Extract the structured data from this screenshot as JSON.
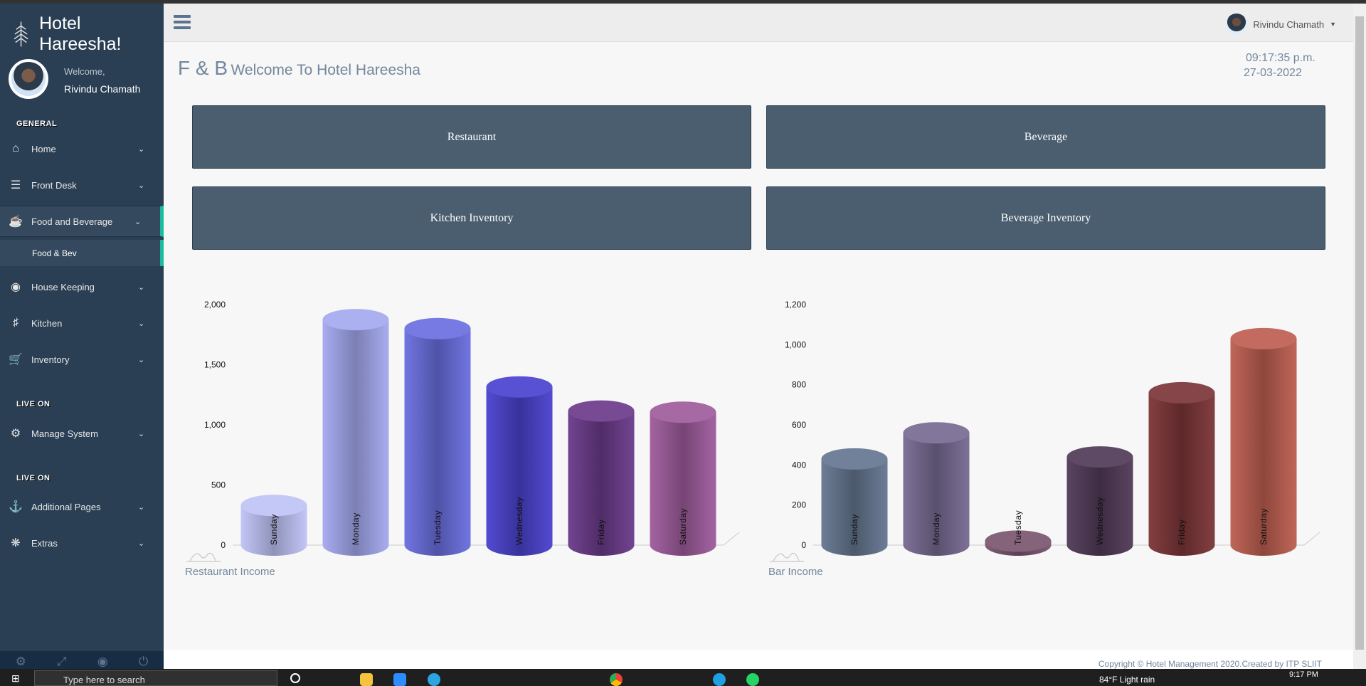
{
  "brand": {
    "title": "Hotel Hareesha!"
  },
  "profile": {
    "welcome": "Welcome,",
    "name": "Rivindu Chamath"
  },
  "sidebar": {
    "sections": [
      "GENERAL",
      "LIVE ON",
      "LIVE ON"
    ],
    "items": [
      {
        "label": "Home",
        "icon": "home-icon"
      },
      {
        "label": "Front Desk",
        "icon": "server-icon"
      },
      {
        "label": "Food and Beverage",
        "icon": "coffee-icon"
      },
      {
        "label": "House Keeping",
        "icon": "life-ring-icon"
      },
      {
        "label": "Kitchen",
        "icon": "cutlery-icon"
      },
      {
        "label": "Inventory",
        "icon": "cart-icon"
      },
      {
        "label": "Manage System",
        "icon": "gear-icon"
      },
      {
        "label": "Additional Pages",
        "icon": "anchor-icon"
      },
      {
        "label": "Extras",
        "icon": "asterisk-icon"
      }
    ],
    "subitem": "Food & Bev",
    "active": "Food and Beverage"
  },
  "header": {
    "user": "Rivindu Chamath"
  },
  "page": {
    "title_big": "F & B",
    "title_small": "Welcome To Hotel Hareesha",
    "time": "09:17:35 p.m.",
    "date": "27-03-2022"
  },
  "tiles": [
    "Restaurant",
    "Beverage",
    "Kitchen Inventory",
    "Beverage Inventory"
  ],
  "footer": {
    "copyright": "Copyright © Hotel Management 2020.Created by ITP SLIIT"
  },
  "taskbar": {
    "search_placeholder": "Type here to search",
    "weather": "84°F  Light rain",
    "time": "9:17 PM"
  },
  "chart_data": [
    {
      "type": "bar",
      "style": "3d-cylinder",
      "title": "Restaurant Income",
      "categories": [
        "Sunday",
        "Monday",
        "Tuesday",
        "Wednesday",
        "Friday",
        "Saturday"
      ],
      "values": [
        330,
        1875,
        1800,
        1315,
        1115,
        1105
      ],
      "yticks": [
        "0",
        "500",
        "1,000",
        "1,500",
        "2,000"
      ],
      "ylim": [
        0,
        2000
      ],
      "colors": [
        "#bfc3f5",
        "#a4a9ef",
        "#6a6edf",
        "#4a42cf",
        "#6b3a8a",
        "#9e5c9c"
      ]
    },
    {
      "type": "bar",
      "style": "3d-cylinder",
      "title": "Bar Income",
      "categories": [
        "Sunday",
        "Monday",
        "Tuesday",
        "Wednesday",
        "Friday",
        "Saturday"
      ],
      "values": [
        430,
        560,
        20,
        440,
        760,
        1030
      ],
      "yticks": [
        "0",
        "200",
        "400",
        "600",
        "800",
        "1,000",
        "1,200"
      ],
      "ylim": [
        0,
        1200
      ],
      "colors": [
        "#657690",
        "#776a92",
        "#7a556f",
        "#513a58",
        "#7c3538",
        "#bd5e50"
      ]
    }
  ]
}
